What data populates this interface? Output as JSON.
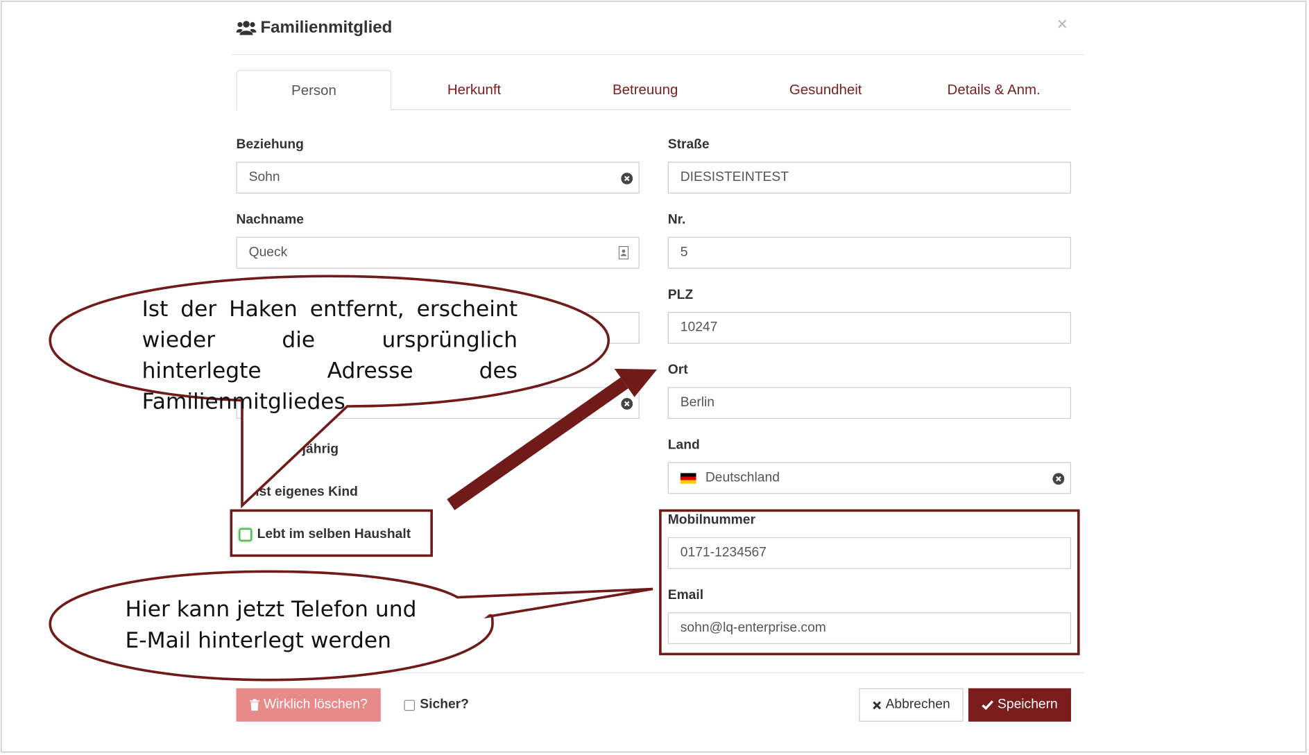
{
  "dialog": {
    "title": "Familienmitglied",
    "title_icon": "users-icon",
    "close_label": "×"
  },
  "tabs": [
    {
      "label": "Person",
      "active": true
    },
    {
      "label": "Herkunft",
      "active": false
    },
    {
      "label": "Betreuung",
      "active": false
    },
    {
      "label": "Gesundheit",
      "active": false
    },
    {
      "label": "Details & Anm.",
      "active": false
    }
  ],
  "left": {
    "beziehung": {
      "label": "Beziehung",
      "value": "Sohn"
    },
    "nachname": {
      "label": "Nachname",
      "value": "Queck"
    },
    "volljaehrig_label": "jährig",
    "eigenes_kind_label": "ist eigenes Kind",
    "haushalt_label": "Lebt im selben Haushalt",
    "haushalt_checked": false
  },
  "right": {
    "strasse": {
      "label": "Straße",
      "value": "DIESISTEINTEST"
    },
    "nr": {
      "label": "Nr.",
      "value": "5"
    },
    "plz": {
      "label": "PLZ",
      "value": "10247"
    },
    "ort": {
      "label": "Ort",
      "value": "Berlin"
    },
    "land": {
      "label": "Land",
      "value": "Deutschland"
    },
    "mobil": {
      "label": "Mobilnummer",
      "value": "0171-1234567"
    },
    "email": {
      "label": "Email",
      "value": "sohn@lq-enterprise.com"
    }
  },
  "footer": {
    "delete_label": "Wirklich löschen?",
    "sicher_label": "Sicher?",
    "cancel_label": "Abbrechen",
    "save_label": "Speichern"
  },
  "callouts": {
    "top": "Ist der Haken entfernt, erscheint wieder die ursprünglich hinterlegte Adresse des Familienmitgliedes",
    "bottom": "Hier kann jetzt Telefon und E-Mail hinterlegt werden"
  },
  "colors": {
    "accent": "#7b1d1d",
    "delete_button": "#e8898a",
    "checkbox_border": "#5cb85c",
    "annotation": "#701a1a"
  }
}
